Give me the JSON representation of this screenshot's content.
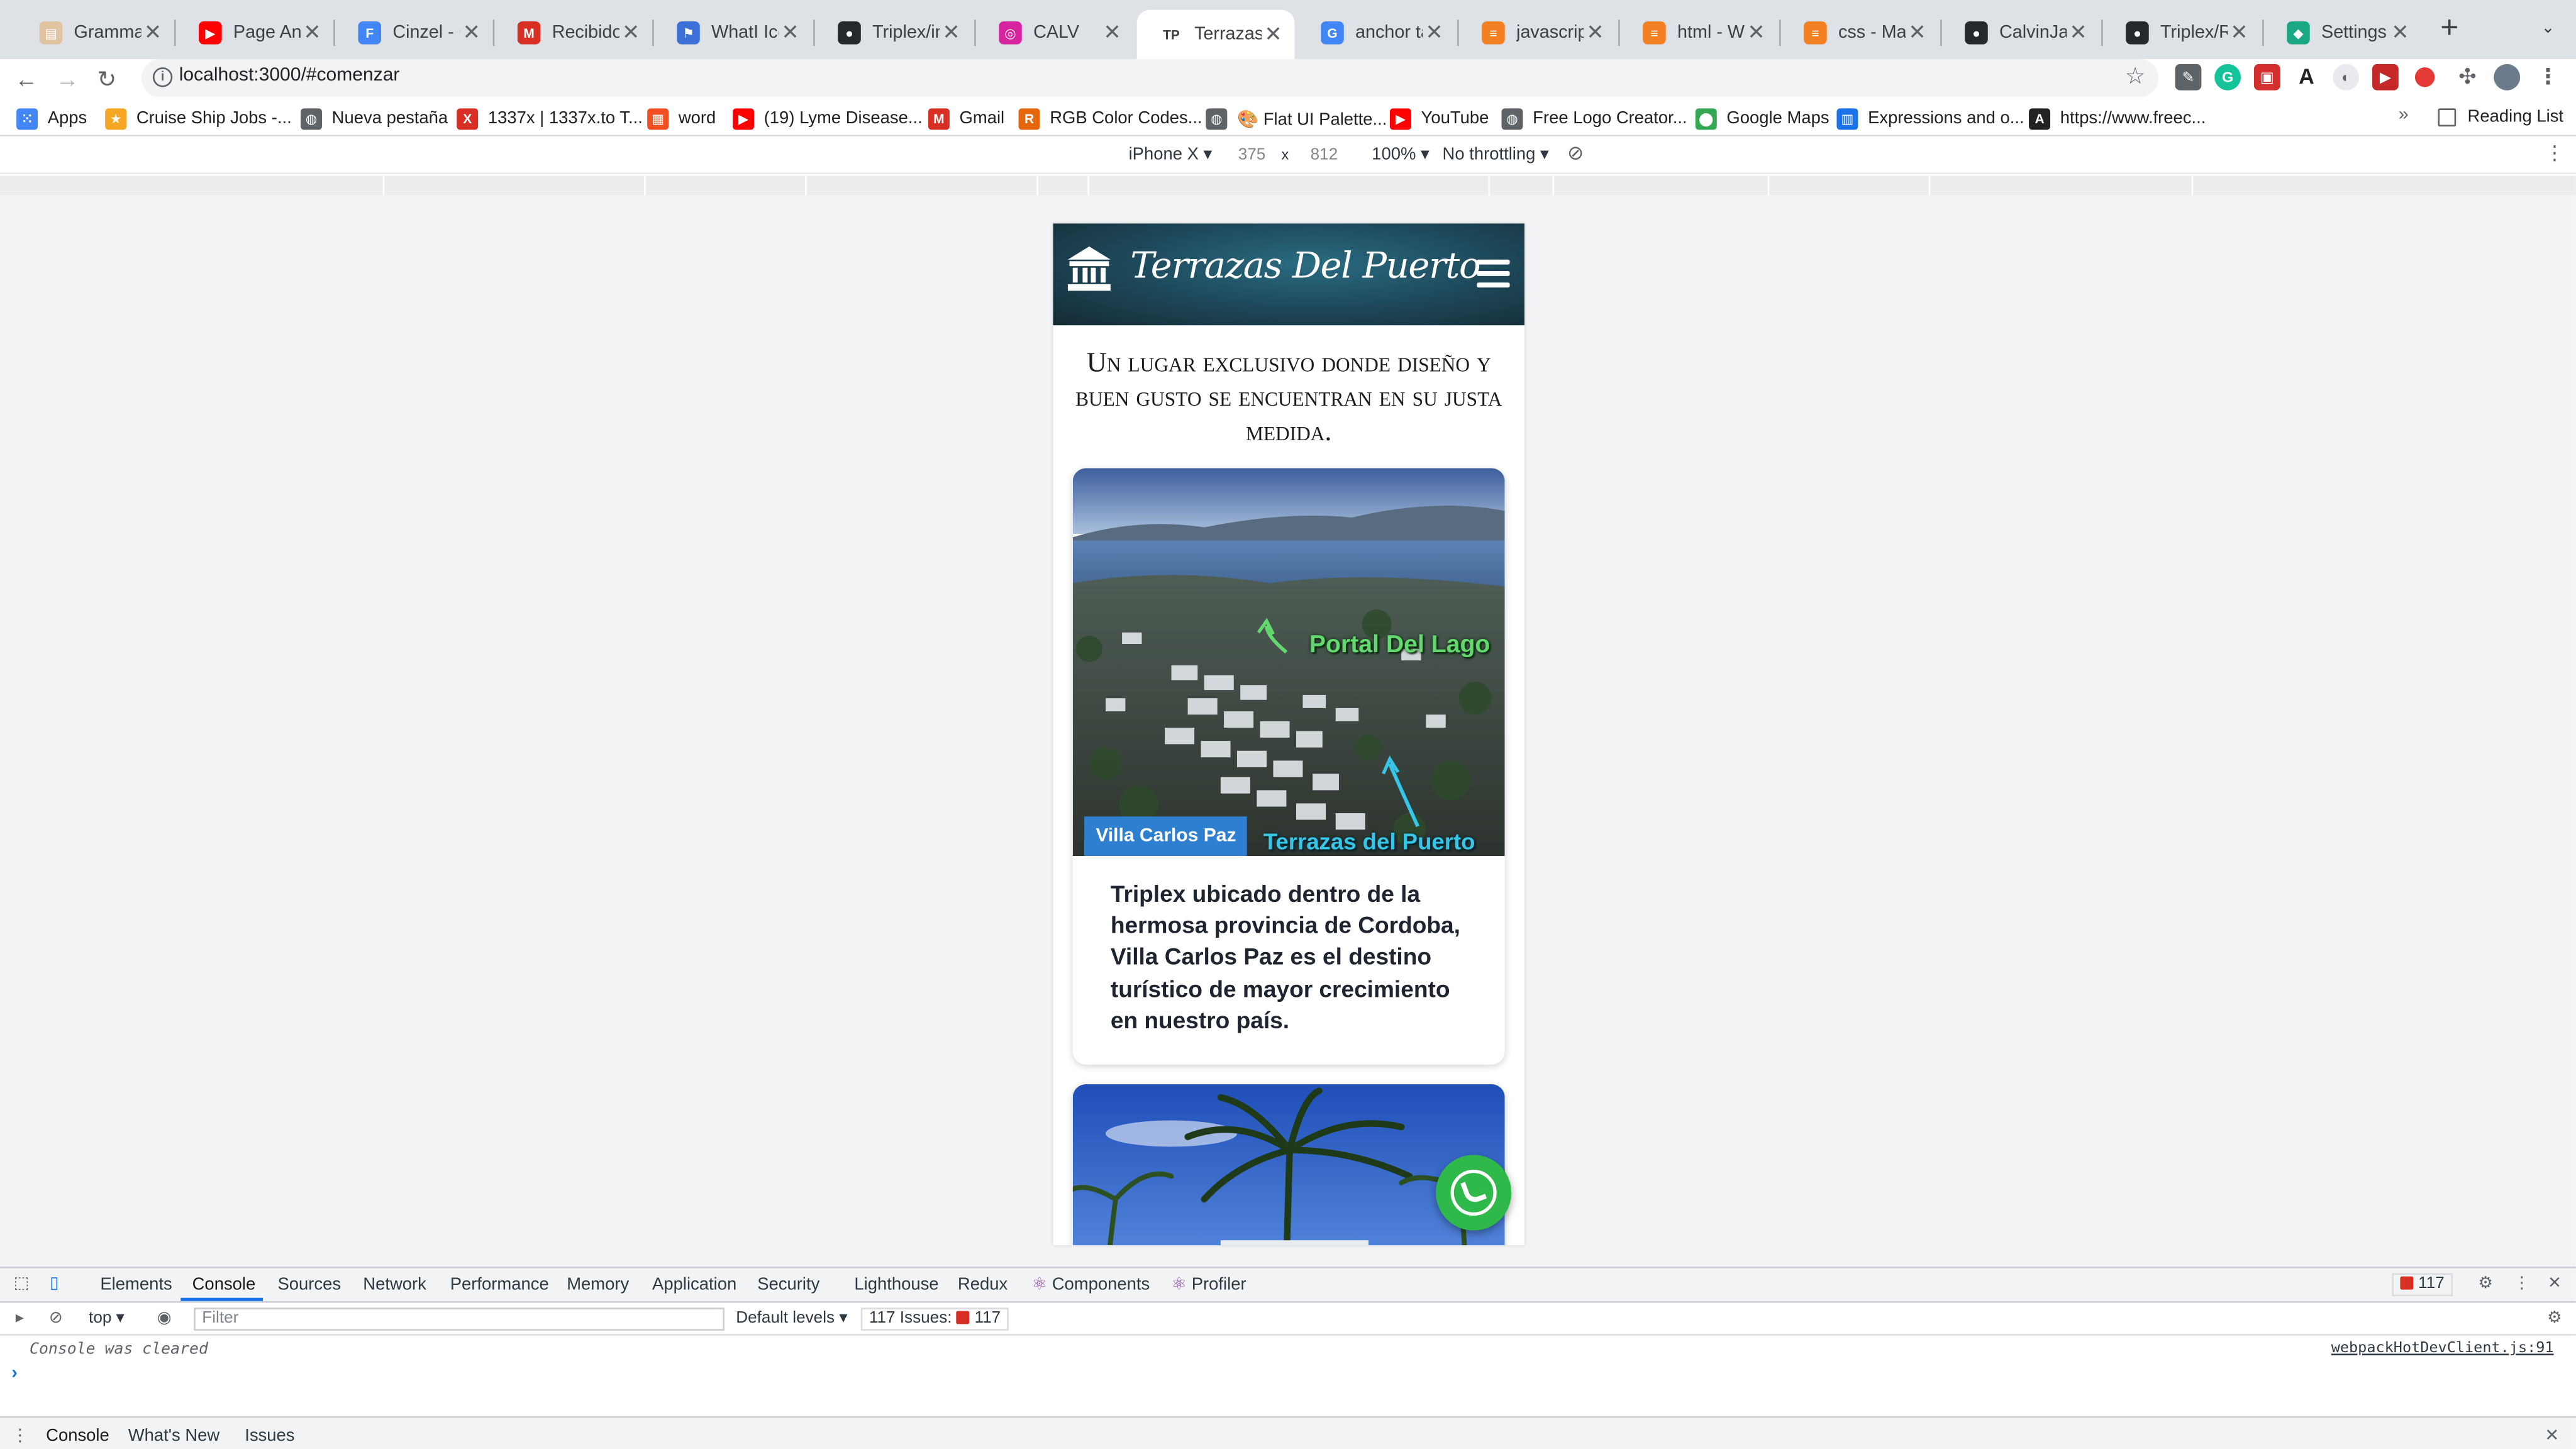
{
  "browser": {
    "tabs": [
      {
        "title": "Grammar C",
        "icon": "document-icon",
        "color": "#e0c3a0",
        "active": false
      },
      {
        "title": "Page Anim",
        "icon": "youtube-icon",
        "color": "#ff0000",
        "active": false
      },
      {
        "title": "Cinzel - Go",
        "icon": "google-fonts-icon",
        "color": "#4285f4",
        "active": false
      },
      {
        "title": "Recibidos (",
        "icon": "gmail-icon",
        "color": "#d93025",
        "active": false
      },
      {
        "title": "WhatI Icon",
        "icon": "flag-icon",
        "color": "#3c6fd8",
        "active": false
      },
      {
        "title": "Triplex/inde",
        "icon": "github-icon",
        "color": "#24292e",
        "active": false
      },
      {
        "title": "CALV",
        "icon": "instagram-icon",
        "color": "#d6249f",
        "active": false
      },
      {
        "title": "Terrazas D",
        "icon": "site-icon",
        "color": "#3c4043",
        "active": true
      },
      {
        "title": "anchor tak",
        "icon": "google-icon",
        "color": "#4285f4",
        "active": false
      },
      {
        "title": "javascript",
        "icon": "stackoverflow-icon",
        "color": "#f48024",
        "active": false
      },
      {
        "title": "html - Why",
        "icon": "stackoverflow-icon",
        "color": "#f48024",
        "active": false
      },
      {
        "title": "css - Make",
        "icon": "stackoverflow-icon",
        "color": "#f48024",
        "active": false
      },
      {
        "title": "CalvinJam",
        "icon": "github-icon",
        "color": "#24292e",
        "active": false
      },
      {
        "title": "Triplex/RE",
        "icon": "github-icon",
        "color": "#24292e",
        "active": false
      },
      {
        "title": "Settings fo",
        "icon": "diamond-icon",
        "color": "#1aa784",
        "active": false
      }
    ],
    "url": "localhost:3000/#comenzar",
    "bookmarks": [
      {
        "label": "Apps",
        "icon": "apps-grid-icon",
        "color": "#4285f4"
      },
      {
        "label": "Cruise Ship Jobs -...",
        "icon": "star-icon",
        "color": "#f5a623"
      },
      {
        "label": "Nueva pestaña",
        "icon": "globe-icon",
        "color": "#5f6368"
      },
      {
        "label": "1337x | 1337x.to T...",
        "icon": "x-logo-icon",
        "color": "#d93025"
      },
      {
        "label": "word",
        "icon": "microsoft-icon",
        "color": "#f25022"
      },
      {
        "label": "(19) Lyme Disease...",
        "icon": "youtube-icon",
        "color": "#ff0000"
      },
      {
        "label": "Gmail",
        "icon": "gmail-icon",
        "color": "#d93025"
      },
      {
        "label": "RGB Color Codes...",
        "icon": "r-logo-icon",
        "color": "#e6660e"
      },
      {
        "label": "🎨 Flat UI Palette...",
        "icon": "globe-icon",
        "color": "#5f6368"
      },
      {
        "label": "YouTube",
        "icon": "youtube-icon",
        "color": "#ff0000"
      },
      {
        "label": "Free Logo Creator...",
        "icon": "globe-icon",
        "color": "#5f6368"
      },
      {
        "label": "Google Maps",
        "icon": "maps-pin-icon",
        "color": "#34a853"
      },
      {
        "label": "Expressions and o...",
        "icon": "book-icon",
        "color": "#1a73e8"
      },
      {
        "label": "https://www.freec...",
        "icon": "a-logo-icon",
        "color": "#222222"
      }
    ],
    "reading_list": "Reading List"
  },
  "device_toolbar": {
    "device": "iPhone X ▾",
    "width": "375",
    "height": "812",
    "zoom": "100% ▾",
    "throttling": "No throttling ▾"
  },
  "site": {
    "title": "Terrazas Del Puerto",
    "hero": "Un lugar exclusivo donde diseño y buen gusto se encuentran en su justa medida.",
    "card1": {
      "badge": "Villa Carlos Paz",
      "label_top": "Portal Del Lago",
      "label_bottom": "Terrazas del Puerto",
      "text": "Triplex ubicado dentro de la hermosa provincia de Cordoba, Villa Carlos Paz es el destino turístico de mayor crecimiento en nuestro país."
    },
    "colors": {
      "header": "#1f4c5f",
      "badge": "#2f7fd1",
      "whatsapp": "#2fb94a"
    }
  },
  "devtools": {
    "tabs": [
      "Elements",
      "Console",
      "Sources",
      "Network",
      "Performance",
      "Memory",
      "Application",
      "Security",
      "Lighthouse",
      "Redux",
      "Components",
      "Profiler"
    ],
    "active_tab": "Console",
    "error_count": "117",
    "context": "top ▾",
    "filter_placeholder": "Filter",
    "levels": "Default levels ▾",
    "issues": "117 Issues:",
    "issues_count": "117",
    "console_message": "Console was cleared",
    "console_source": "webpackHotDevClient.js:91",
    "drawer_tabs": [
      "Console",
      "What's New",
      "Issues"
    ]
  }
}
